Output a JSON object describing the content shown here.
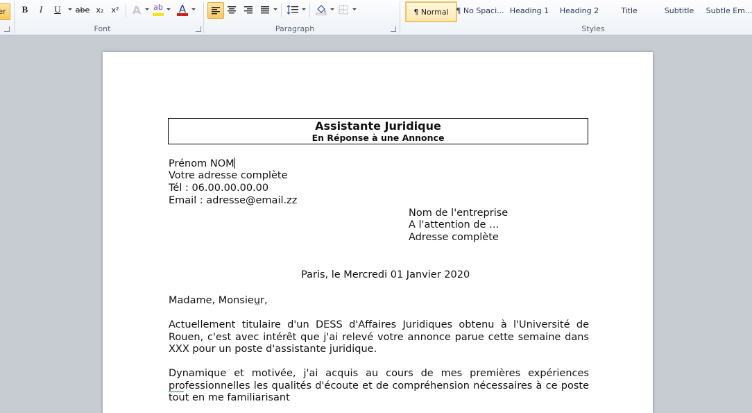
{
  "ribbon": {
    "left_cutoff_label": "ter",
    "font_group": {
      "label": "Font",
      "bold": "B",
      "italic": "I",
      "underline": "U",
      "strikethrough": "abe",
      "subscript": "x₂",
      "superscript": "x²",
      "text_effects": "A",
      "highlight": "ab",
      "font_color": "A",
      "highlight_color": "#f5e31a",
      "font_color_value": "#d0201b"
    },
    "paragraph_group": {
      "label": "Paragraph"
    },
    "styles_group": {
      "label": "Styles",
      "items": [
        "¶ Normal",
        "¶ No Spaci...",
        "Heading 1",
        "Heading 2",
        "Title",
        "Subtitle",
        "Subtle Em..."
      ]
    }
  },
  "document": {
    "title": "Assistante Juridique",
    "subtitle": "En Réponse à une Annonce",
    "sender": [
      "Prénom NOM",
      "Votre adresse complète",
      "Tél : 06.00.00.00.00",
      "Email : adresse@email.zz"
    ],
    "recipient": [
      "Nom de l'entreprise",
      "A l'attention de …",
      "Adresse complète"
    ],
    "date_line": "Paris, le Mercredi 01 Janvier 2020",
    "salutation": "Madame, Monsieur,",
    "paragraph1": "Actuellement titulaire d'un DESS d'Affaires Juridiques obtenu à l'Université de Rouen, c'est avec intérêt que j'ai relevé votre annonce parue cette semaine dans XXX pour un poste d'assistante juridique.",
    "paragraph2": "Dynamique et motivée, j'ai acquis au cours de mes premières expériences professionnelles les qualités d'écoute et de compréhension nécessaires à ce poste tout en me familiarisant"
  }
}
